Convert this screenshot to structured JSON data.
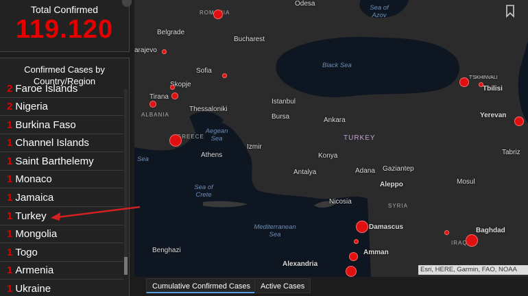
{
  "total": {
    "title": "Total Confirmed",
    "value": "119.120"
  },
  "list": {
    "title_line1": "Confirmed Cases by",
    "title_line2": "Country/Region",
    "rows": [
      {
        "count": "2",
        "name": "Faroe Islands"
      },
      {
        "count": "2",
        "name": "Nigeria"
      },
      {
        "count": "1",
        "name": "Burkina Faso"
      },
      {
        "count": "1",
        "name": "Channel Islands"
      },
      {
        "count": "1",
        "name": "Saint Barthelemy"
      },
      {
        "count": "1",
        "name": "Monaco"
      },
      {
        "count": "1",
        "name": "Jamaica"
      },
      {
        "count": "1",
        "name": "Turkey"
      },
      {
        "count": "1",
        "name": "Mongolia"
      },
      {
        "count": "1",
        "name": "Togo"
      },
      {
        "count": "1",
        "name": "Armenia"
      },
      {
        "count": "1",
        "name": "Ukraine"
      }
    ]
  },
  "map": {
    "cities": [
      "Belgrade",
      "Bucharest",
      "arajevo",
      "Sofia",
      "Skopje",
      "Tirana",
      "Thessaloniki",
      "Istanbul",
      "Bursa",
      "Ankara",
      "Izmir",
      "Athens",
      "Konya",
      "Antalya",
      "Adana",
      "Gaziantep",
      "Aleppo",
      "Nicosia",
      "Damascus",
      "Amman",
      "Alexandria",
      "Tbilisi",
      "Yerevan",
      "Tabriz",
      "Mosul",
      "Baghdad",
      "Benghazi",
      "T'SKHINVALI"
    ],
    "seas": [
      "Black Sea",
      "Aegean Sea",
      "Sea",
      "Sea of Crete",
      "Mediterranean Sea",
      "Sea of Azov"
    ],
    "countries": [
      "ROMANIA",
      "TURKEY",
      "GREECE",
      "ALBANIA",
      "SYRIA",
      "IRAQ"
    ],
    "partial": [
      "Odesa"
    ],
    "attribution": "Esri, HERE, Garmin, FAO, NOAA"
  },
  "tabs": {
    "cumulative": "Cumulative Confirmed Cases",
    "active": "Active Cases"
  },
  "colors": {
    "accent": "#e60000",
    "background": "#1c1c1c",
    "map_land": "#2b2b2b",
    "map_water": "#0e1622"
  }
}
